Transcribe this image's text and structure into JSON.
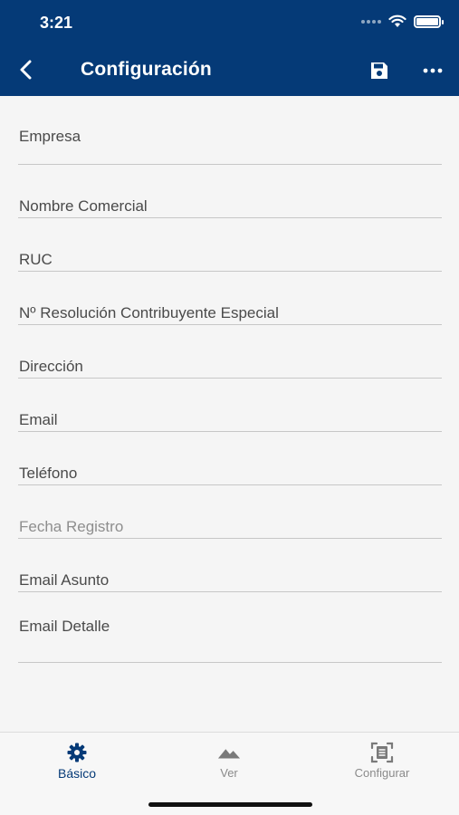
{
  "status_bar": {
    "time": "3:21"
  },
  "app_bar": {
    "title": "Configuración",
    "back_icon": "chevron-left-icon",
    "save_icon": "save-icon",
    "more_icon": "more-horizontal-icon"
  },
  "form": {
    "fields": [
      {
        "label": "Empresa",
        "disabled": false
      },
      {
        "label": "Nombre Comercial",
        "disabled": false
      },
      {
        "label": "RUC",
        "disabled": false
      },
      {
        "label": "Nº Resolución Contribuyente Especial",
        "disabled": false
      },
      {
        "label": "Dirección",
        "disabled": false
      },
      {
        "label": "Email",
        "disabled": false
      },
      {
        "label": "Teléfono",
        "disabled": false
      },
      {
        "label": "Fecha Registro",
        "disabled": true
      },
      {
        "label": "Email Asunto",
        "disabled": false
      },
      {
        "label": "Email Detalle",
        "disabled": false
      }
    ]
  },
  "tab_bar": {
    "tabs": [
      {
        "label": "Básico",
        "icon": "gear-icon",
        "active": true
      },
      {
        "label": "Ver",
        "icon": "mountain-icon",
        "active": false
      },
      {
        "label": "Configurar",
        "icon": "scan-document-icon",
        "active": false
      }
    ]
  },
  "colors": {
    "primary": "#053a77",
    "background": "#f5f5f5",
    "divider": "#c7c7c7",
    "inactive": "#8a8a8a"
  }
}
